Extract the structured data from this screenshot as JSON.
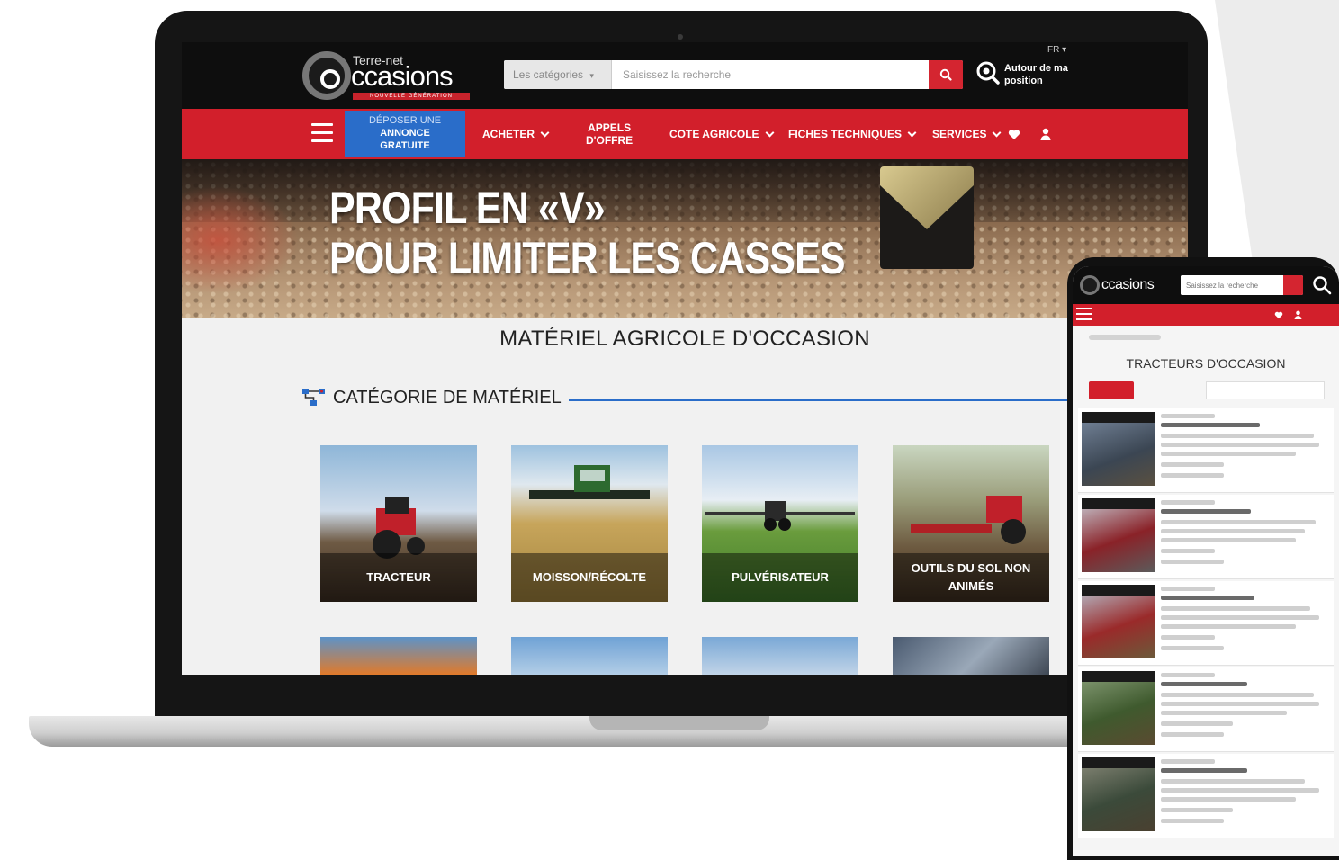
{
  "site": {
    "logo_small": "Terre-net",
    "logo_big": "ccasions",
    "logo_tagline": "NOUVELLE GÉNÉRATION",
    "lang": "FR"
  },
  "search": {
    "category_label": "Les catégories",
    "placeholder": "Saisissez la recherche"
  },
  "location": {
    "label": "Autour de ma position"
  },
  "nav": {
    "deposit_line1": "DÉPOSER UNE",
    "deposit_line2": "ANNONCE",
    "deposit_line3": "GRATUITE",
    "items": [
      {
        "label": "ACHETER"
      },
      {
        "label": "APPELS"
      },
      {
        "label": "D'OFFRE"
      },
      {
        "label": "COTE AGRICOLE"
      },
      {
        "label": "FICHES TECHNIQUES"
      },
      {
        "label": "SERVICES"
      }
    ]
  },
  "hero": {
    "line1": "PROFIL EN «V»",
    "line2": "POUR LIMITER LES CASSES"
  },
  "main": {
    "title": "MATÉRIEL AGRICOLE D'OCCASION",
    "category_heading": "CATÉGORIE DE MATÉRIEL",
    "categories": [
      {
        "label": "TRACTEUR"
      },
      {
        "label": "MOISSON/RÉCOLTE"
      },
      {
        "label": "PULVÉRISATEUR"
      },
      {
        "label": "OUTILS DU SOL NON ANIMÉS"
      }
    ]
  },
  "phone": {
    "logo_text": "ccasions",
    "title": "TRACTEURS D'OCCASION"
  },
  "colors": {
    "brand_red": "#d21f2b",
    "brand_blue": "#2a6dc9",
    "header_black": "#0e0e0e"
  },
  "icons": [
    "search-icon",
    "location-icon",
    "menu-icon",
    "heart-icon",
    "user-icon",
    "chevron-down-icon",
    "category-icon"
  ]
}
